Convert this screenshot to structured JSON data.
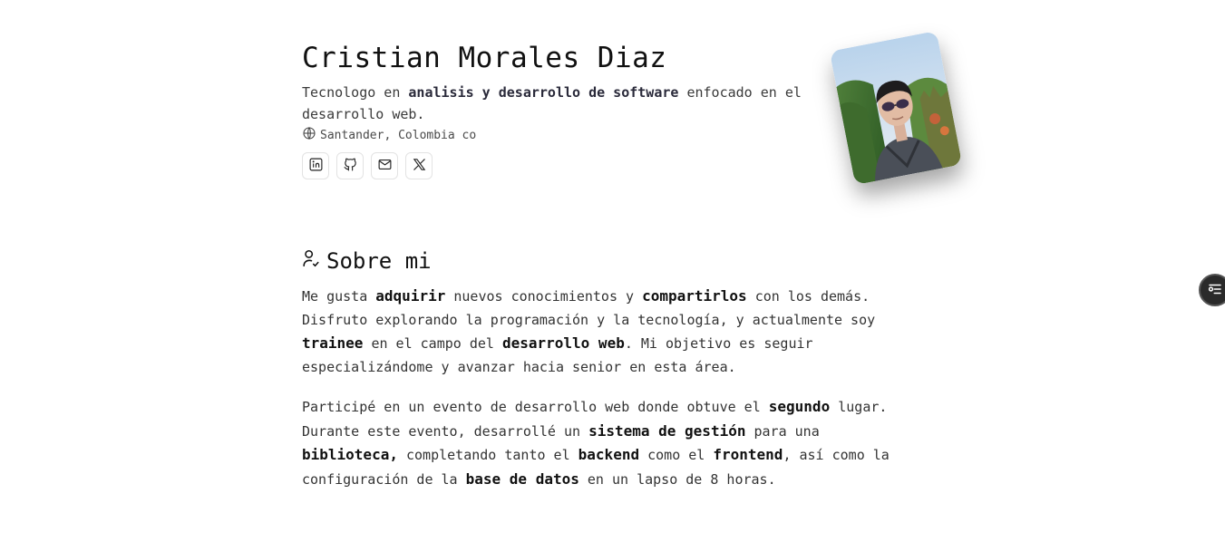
{
  "profile": {
    "name": "Cristian Morales Diaz",
    "tagline_pre": "Tecnologo en ",
    "tagline_bold": "analisis y desarrollo de software",
    "tagline_post": " enfocado en el desarrollo web.",
    "location": "Santander, Colombia co"
  },
  "socials": [
    {
      "icon": "linkedin-icon",
      "label": "LinkedIn"
    },
    {
      "icon": "github-icon",
      "label": "GitHub"
    },
    {
      "icon": "mail-icon",
      "label": "Email"
    },
    {
      "icon": "x-icon",
      "label": "X"
    }
  ],
  "about": {
    "title": "Sobre mi",
    "p1": [
      {
        "t": "Me gusta "
      },
      {
        "b": "adquirir"
      },
      {
        "t": " nuevos conocimientos y "
      },
      {
        "b": "compartirlos"
      },
      {
        "t": " con los demás. Disfruto explorando la programación y la tecnología, y actualmente soy "
      },
      {
        "b": "trainee"
      },
      {
        "t": " en el campo del "
      },
      {
        "b": "desarrollo web"
      },
      {
        "t": ". Mi objetivo es seguir especializándome y avanzar hacia senior en esta área."
      }
    ],
    "p2": [
      {
        "t": "Participé en un evento de desarrollo web donde obtuve el "
      },
      {
        "b": "segundo"
      },
      {
        "t": " lugar. Durante este evento, desarrollé un "
      },
      {
        "b": "sistema de gestión"
      },
      {
        "t": " para una "
      },
      {
        "b": "biblioteca,"
      },
      {
        "t": " completando tanto el "
      },
      {
        "b": "backend"
      },
      {
        "t": " como el "
      },
      {
        "b": "frontend"
      },
      {
        "t": ", así como la configuración de la "
      },
      {
        "b": "base de datos"
      },
      {
        "t": " en un lapso de 8 horas."
      }
    ]
  },
  "colors": {
    "background": "#ffffff",
    "text": "#333333",
    "toggle_bg": "#2a2a2a"
  }
}
